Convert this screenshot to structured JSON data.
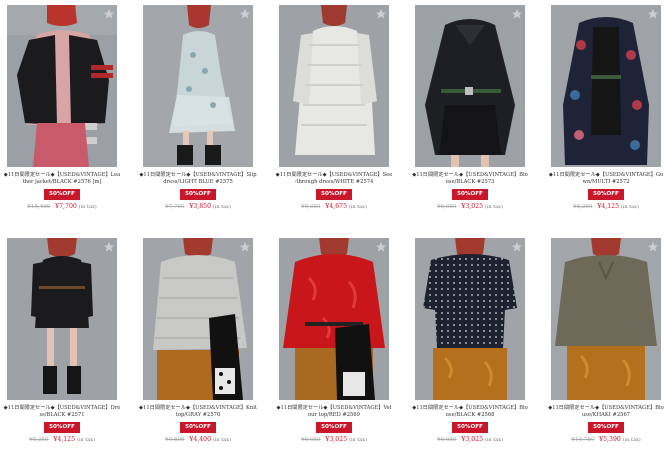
{
  "colors": {
    "sale": "#c9162b",
    "star": "#d0d0d0"
  },
  "products": [
    {
      "title": "◆11日間限定セール◆【USED&VINTAGE】Leather jacket/BLACK #2576 [m]",
      "badge": "50%OFF",
      "old_price": "¥15,400",
      "price": "¥7,700",
      "tax": "(in tax)"
    },
    {
      "title": "◆11日間限定セール◆【USED&VINTAGE】Slip dress/LIGHT BLUE #2575",
      "badge": "50%OFF",
      "old_price": "¥7,700",
      "price": "¥3,850",
      "tax": "(in tax)"
    },
    {
      "title": "◆11日間限定セール◆【USED&VINTAGE】See-through dress/WHITE #2574",
      "badge": "50%OFF",
      "old_price": "¥9,350",
      "price": "¥4,675",
      "tax": "(in tax)"
    },
    {
      "title": "◆11日間限定セール◆【USED&VINTAGE】Blouse/BLACK #2573",
      "badge": "50%OFF",
      "old_price": "¥6,050",
      "price": "¥3,025",
      "tax": "(in tax)"
    },
    {
      "title": "◆11日間限定セール◆【USED&VINTAGE】Gown/MULTI #2572",
      "badge": "50%OFF",
      "old_price": "¥8,250",
      "price": "¥4,125",
      "tax": "(in tax)"
    },
    {
      "title": "◆11日間限定セール◆【USED&VINTAGE】Dress/BLACK #2571",
      "badge": "50%OFF",
      "old_price": "¥8,250",
      "price": "¥4,125",
      "tax": "(in tax)"
    },
    {
      "title": "◆11日間限定セール◆【USED&VINTAGE】Knit top/GRAY #2570",
      "badge": "50%OFF",
      "old_price": "¥9,800",
      "price": "¥4,400",
      "tax": "(in tax)"
    },
    {
      "title": "◆11日間限定セール◆【USED&VINTAGE】Velour top/RED #2569",
      "badge": "50%OFF",
      "old_price": "¥6,050",
      "price": "¥3,025",
      "tax": "(in tax)"
    },
    {
      "title": "◆11日間限定セール◆【USED&VINTAGE】Blouse/BLACK #2568",
      "badge": "50%OFF",
      "old_price": "¥6,050",
      "price": "¥3,025",
      "tax": "(in tax)"
    },
    {
      "title": "◆11日間限定セール◆【USED&VINTAGE】Blouse/KHAKI #2567",
      "badge": "50%OFF",
      "old_price": "¥10,780",
      "price": "¥5,390",
      "tax": "(in tax)"
    }
  ]
}
